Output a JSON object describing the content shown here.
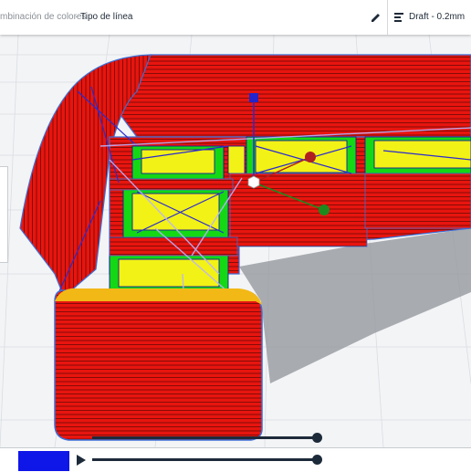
{
  "header": {
    "breadcrumb_prev": "mbinación de colores",
    "breadcrumb_separator": "·",
    "breadcrumb_current": "Tipo de línea",
    "profile_label": "Draft - 0.2mm"
  },
  "icons": {
    "edit": "pencil-icon",
    "profile": "print-settings-icon",
    "play": "play-icon"
  },
  "colors": {
    "wall_outer": "#e8150f",
    "infill_skin": "#f2f216",
    "support_interface": "#14d814",
    "travel": "#2b2bd0",
    "layer_view_accent": "#0f16e8",
    "slider": "#1d2a3a"
  },
  "layer_view": {
    "progress_fraction": 0.11
  }
}
